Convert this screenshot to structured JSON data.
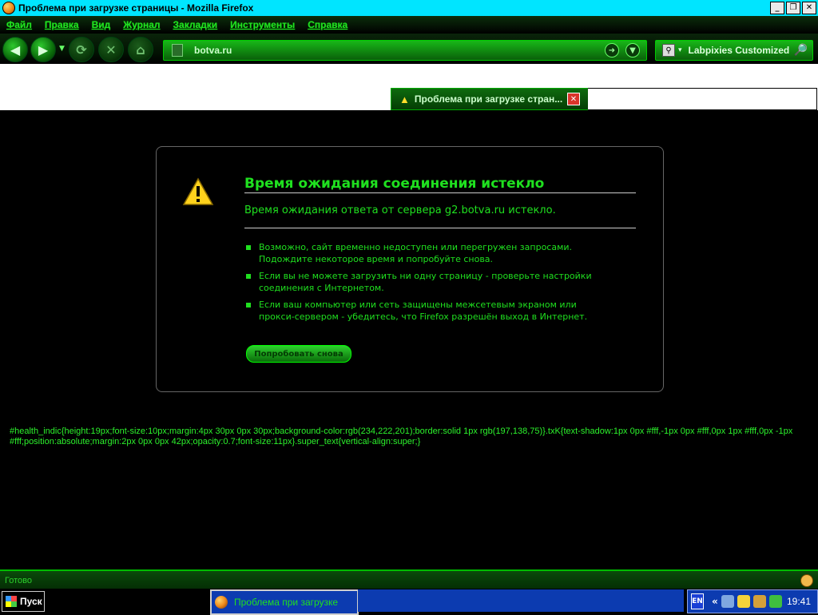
{
  "window": {
    "title": "Проблема при загрузке страницы - Mozilla Firefox",
    "min_icon": "minimize-icon",
    "max_icon": "restore-icon",
    "close_icon": "close-icon"
  },
  "menu": {
    "items": [
      "Файл",
      "Правка",
      "Вид",
      "Журнал",
      "Закладки",
      "Инструменты",
      "Справка"
    ]
  },
  "nav": {
    "url": "botva.ru",
    "search_engine": "Labpixies Customized"
  },
  "tab": {
    "label": "Проблема при загрузке стран..."
  },
  "error": {
    "title": "Время ожидания соединения истекло",
    "description": "Время ожидания ответа от сервера g2.botva.ru истекло.",
    "items": [
      "Возможно, сайт временно недоступен или перегружен запросами. Подождите некоторое время и попробуйте снова.",
      "Если вы не можете загрузить ни одну страницу - проверьте настройки соединения с Интернетом.",
      "Если ваш компьютер или сеть защищены межсетевым экраном или прокси-сервером - убедитесь, что Firefox разрешён выход в Интернет."
    ],
    "retry_label": "Попробовать снова"
  },
  "css_dump": "#health_indic{height:19px;font-size:10px;margin:4px 30px 0px 30px;background-color:rgb(234,222,201);border:solid 1px rgb(197,138,75)}.txK{text-shadow:1px 0px #fff,-1px 0px #fff,0px 1px #fff,0px -1px #fff;position:absolute;margin:2px 0px 0px 42px;opacity:0.7;font-size:11px}.super_text{vertical-align:super;}",
  "status": {
    "text": "Готово"
  },
  "taskbar": {
    "start_label": "Пуск",
    "task_label": "Проблема при загрузке",
    "lang": "EN",
    "chevrons": "«",
    "clock": "19:41"
  },
  "colors": {
    "accent": "#1fe01f",
    "title_bar": "#00e5ff",
    "taskbar_blue": "#0c3bb0"
  }
}
